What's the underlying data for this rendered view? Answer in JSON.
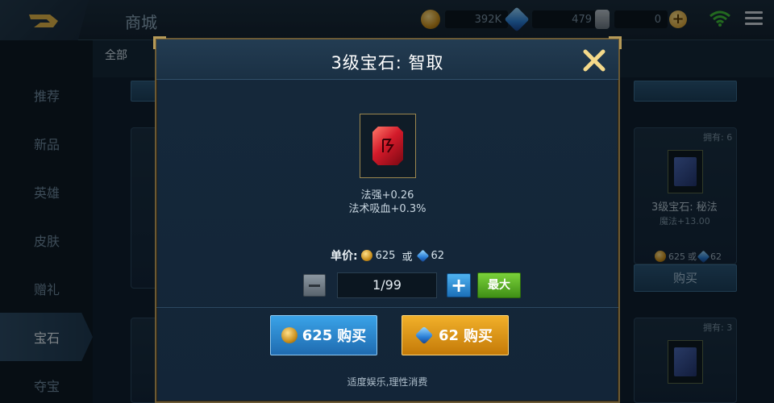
{
  "header": {
    "title": "商城",
    "gold_value": "392K",
    "diamond_value": "479",
    "gem_value": "0",
    "plus_label": "+"
  },
  "tabs": {
    "all_label": "全部"
  },
  "sidebar": {
    "items": [
      {
        "label": "推荐"
      },
      {
        "label": "新品"
      },
      {
        "label": "英雄"
      },
      {
        "label": "皮肤"
      },
      {
        "label": "赠礼"
      },
      {
        "label": "宝石"
      },
      {
        "label": "夺宝"
      }
    ],
    "active_index": 5
  },
  "background_cards": {
    "owned_top": "拥有: 6",
    "card_name": "3级宝石: 秘法",
    "card_stat": "魔法+13.00",
    "price_gold": "625",
    "price_or": "或",
    "price_diamond": "62",
    "buy_label": "购买",
    "owned_bottom": "拥有: 3"
  },
  "dialog": {
    "title": "3级宝石: 智取",
    "close_icon": "close-icon",
    "stats": [
      "法强+0.26",
      "法术吸血+0.3%"
    ],
    "unit_price_label": "单价:",
    "unit_price_gold": "625",
    "or_label": "或",
    "unit_price_diamond": "62",
    "quantity_value": "1/99",
    "minus_label": "−",
    "plus_label": "+",
    "max_label": "最大",
    "buy_gold_amount": "625",
    "buy_gold_label": "购买",
    "buy_diamond_amount": "62",
    "buy_diamond_label": "购买",
    "footer_note": "适度娱乐,理性消费"
  },
  "colors": {
    "gold_button": "#f1b02a",
    "blue_button": "#3aa3e8",
    "max_button": "#5cb226",
    "border_gold": "#b59a58"
  }
}
